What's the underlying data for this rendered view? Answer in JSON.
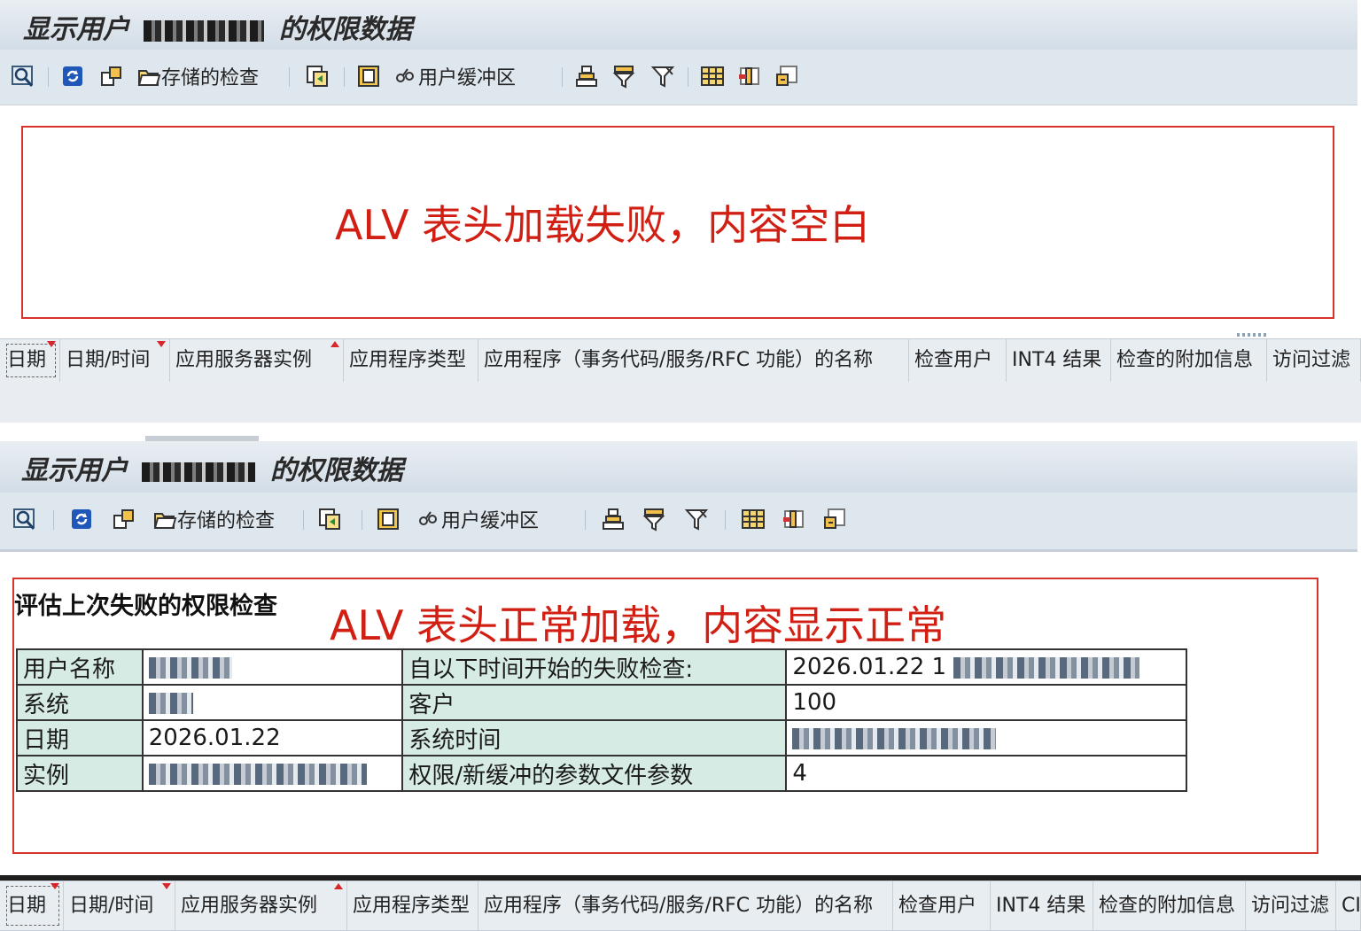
{
  "panel_top": {
    "title_prefix": "显示用户",
    "title_suffix": "的权限数据",
    "caption": "ALV 表头加载失败，内容空白"
  },
  "panel_bottom": {
    "title_prefix": "显示用户",
    "title_suffix": "的权限数据",
    "caption": "ALV 表头正常加载，内容显示正常",
    "heading": "评估上次失败的权限检查",
    "rows": [
      {
        "label1": "用户名称",
        "value1": "",
        "label2": "自以下时间开始的失败检查:",
        "value2": "2026.01.22 1"
      },
      {
        "label1": "系统",
        "value1": "",
        "label2": "客户",
        "value2": "100"
      },
      {
        "label1": "日期",
        "value1": "2026.01.22",
        "label2": "系统时间",
        "value2": ""
      },
      {
        "label1": "实例",
        "value1": "",
        "label2": "权限/新缓冲的参数文件参数",
        "value2": "4"
      }
    ]
  },
  "toolbar": {
    "stored_checks_label": "存储的检查",
    "user_buffer_label": "用户缓冲区",
    "icons": [
      "find-icon",
      "refresh-icon",
      "export-icon",
      "stored-checks-icon",
      "copy-icon",
      "layout-icon",
      "user-buffer-icon",
      "sort-icon",
      "filter-icon",
      "filter-off-icon",
      "grid-icon",
      "columns-icon",
      "details-icon"
    ]
  },
  "columns": [
    {
      "label": "日期",
      "sort": "down"
    },
    {
      "label": "日期/时间",
      "sort": "down"
    },
    {
      "label": "应用服务器实例",
      "sort": "up"
    },
    {
      "label": "应用程序类型",
      "sort": ""
    },
    {
      "label": "应用程序（事务代码/服务/RFC 功能）的名称",
      "sort": ""
    },
    {
      "label": "检查用户",
      "sort": ""
    },
    {
      "label": "INT4 结果",
      "sort": ""
    },
    {
      "label": "检查的附加信息",
      "sort": ""
    },
    {
      "label": "访问过滤",
      "sort": ""
    },
    {
      "label": "CI",
      "sort": ""
    }
  ],
  "colors": {
    "highlight_red": "#d11f14",
    "header_label_bg": "#d6ebe3",
    "toolbar_bg": "#dfe7ee",
    "title_bg": "#d3dde7"
  }
}
